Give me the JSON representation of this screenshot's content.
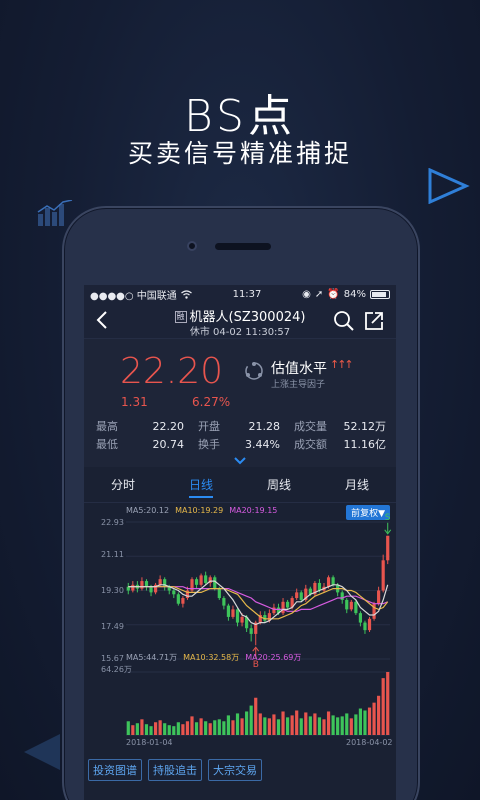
{
  "promo": {
    "title": "BS点",
    "subtitle": "买卖信号精准捕捉"
  },
  "statusbar": {
    "carrier": "●●●●○ 中国联通",
    "time": "11:37",
    "battery": "84%"
  },
  "nav": {
    "badge": "融",
    "title": "机器人(SZ300024)",
    "subtitle": "休市 04-02 11:30:57"
  },
  "quote": {
    "price": "22.20",
    "change": "1.31",
    "change_pct": "6.27%",
    "valuation_label": "估值水平",
    "valuation_arrows": "↑↑↑",
    "valuation_sub": "上涨主导因子",
    "stats": [
      [
        {
          "label": "最高",
          "value": "22.20"
        },
        {
          "label": "开盘",
          "value": "21.28"
        },
        {
          "label": "成交量",
          "value": "52.12万"
        }
      ],
      [
        {
          "label": "最低",
          "value": "20.74"
        },
        {
          "label": "换手",
          "value": "3.44%"
        },
        {
          "label": "成交额",
          "value": "11.16亿"
        }
      ]
    ]
  },
  "tabs": [
    {
      "label": "分时",
      "active": false
    },
    {
      "label": "日线",
      "active": true
    },
    {
      "label": "周线",
      "active": false
    },
    {
      "label": "月线",
      "active": false
    }
  ],
  "chart_data": {
    "type": "candlestick",
    "ma_legend": {
      "ma5": "MA5:20.12",
      "ma10": "MA10:19.29",
      "ma20": "MA20:19.15"
    },
    "adjust_button": "前复权▼",
    "y_ticks": [
      "22.93",
      "21.11",
      "19.30",
      "17.49",
      "15.67"
    ],
    "ylim": [
      15.67,
      22.93
    ],
    "vol_legend": {
      "ma5": "MA5:44.71万",
      "ma10": "MA10:32.58万",
      "ma20": "MA20:25.69万"
    },
    "vol_max_label": "64.26万",
    "vol_max": 64.26,
    "x_start": "2018-01-04",
    "x_end": "2018-04-02",
    "signals": [
      {
        "label": "S",
        "index": 57
      },
      {
        "label": "B",
        "index": 28
      }
    ],
    "colors": {
      "up": "#e8554e",
      "down": "#3ec45b",
      "ma5": "#d8d8d8",
      "ma10": "#e6b84a",
      "ma20": "#d65be0"
    },
    "candles": [
      {
        "o": 19.5,
        "c": 19.3,
        "h": 19.7,
        "l": 19.1
      },
      {
        "o": 19.3,
        "c": 19.6,
        "h": 19.8,
        "l": 19.2
      },
      {
        "o": 19.6,
        "c": 19.4,
        "h": 19.8,
        "l": 19.2
      },
      {
        "o": 19.4,
        "c": 19.8,
        "h": 20.0,
        "l": 19.3
      },
      {
        "o": 19.8,
        "c": 19.5,
        "h": 19.9,
        "l": 19.3
      },
      {
        "o": 19.5,
        "c": 19.2,
        "h": 19.6,
        "l": 19.0
      },
      {
        "o": 19.2,
        "c": 19.6,
        "h": 19.7,
        "l": 19.1
      },
      {
        "o": 19.6,
        "c": 19.9,
        "h": 20.1,
        "l": 19.5
      },
      {
        "o": 19.9,
        "c": 19.5,
        "h": 20.0,
        "l": 19.3
      },
      {
        "o": 19.5,
        "c": 19.3,
        "h": 19.6,
        "l": 19.1
      },
      {
        "o": 19.3,
        "c": 19.1,
        "h": 19.4,
        "l": 18.9
      },
      {
        "o": 19.1,
        "c": 18.6,
        "h": 19.2,
        "l": 18.5
      },
      {
        "o": 18.6,
        "c": 18.9,
        "h": 19.0,
        "l": 18.4
      },
      {
        "o": 18.9,
        "c": 19.3,
        "h": 19.5,
        "l": 18.8
      },
      {
        "o": 19.3,
        "c": 19.9,
        "h": 20.0,
        "l": 19.2
      },
      {
        "o": 19.9,
        "c": 19.6,
        "h": 20.0,
        "l": 19.4
      },
      {
        "o": 19.6,
        "c": 20.1,
        "h": 20.2,
        "l": 19.5
      },
      {
        "o": 20.1,
        "c": 19.7,
        "h": 20.3,
        "l": 19.6
      },
      {
        "o": 19.7,
        "c": 20.0,
        "h": 20.1,
        "l": 19.5
      },
      {
        "o": 20.0,
        "c": 19.4,
        "h": 20.1,
        "l": 19.3
      },
      {
        "o": 19.4,
        "c": 18.9,
        "h": 19.5,
        "l": 18.8
      },
      {
        "o": 18.9,
        "c": 18.5,
        "h": 19.0,
        "l": 18.3
      },
      {
        "o": 18.5,
        "c": 17.9,
        "h": 18.6,
        "l": 17.7
      },
      {
        "o": 17.9,
        "c": 18.3,
        "h": 18.5,
        "l": 17.8
      },
      {
        "o": 18.3,
        "c": 17.6,
        "h": 18.4,
        "l": 17.4
      },
      {
        "o": 17.6,
        "c": 17.9,
        "h": 18.1,
        "l": 17.4
      },
      {
        "o": 17.9,
        "c": 17.3,
        "h": 18.0,
        "l": 17.1
      },
      {
        "o": 17.3,
        "c": 17.0,
        "h": 17.5,
        "l": 16.6
      },
      {
        "o": 17.0,
        "c": 17.6,
        "h": 17.7,
        "l": 16.4
      },
      {
        "o": 17.6,
        "c": 18.0,
        "h": 18.2,
        "l": 17.5
      },
      {
        "o": 18.0,
        "c": 17.7,
        "h": 18.2,
        "l": 17.6
      },
      {
        "o": 17.7,
        "c": 18.1,
        "h": 18.3,
        "l": 17.6
      },
      {
        "o": 18.1,
        "c": 18.4,
        "h": 18.6,
        "l": 18.0
      },
      {
        "o": 18.4,
        "c": 18.1,
        "h": 18.6,
        "l": 18.0
      },
      {
        "o": 18.1,
        "c": 18.7,
        "h": 18.9,
        "l": 18.0
      },
      {
        "o": 18.7,
        "c": 18.4,
        "h": 18.8,
        "l": 18.3
      },
      {
        "o": 18.4,
        "c": 18.9,
        "h": 19.0,
        "l": 18.3
      },
      {
        "o": 18.9,
        "c": 19.2,
        "h": 19.4,
        "l": 18.8
      },
      {
        "o": 19.2,
        "c": 18.8,
        "h": 19.3,
        "l": 18.7
      },
      {
        "o": 18.8,
        "c": 19.4,
        "h": 19.6,
        "l": 18.7
      },
      {
        "o": 19.4,
        "c": 19.1,
        "h": 19.5,
        "l": 19.0
      },
      {
        "o": 19.1,
        "c": 19.7,
        "h": 19.8,
        "l": 19.0
      },
      {
        "o": 19.7,
        "c": 19.3,
        "h": 19.9,
        "l": 19.2
      },
      {
        "o": 19.3,
        "c": 19.5,
        "h": 19.7,
        "l": 19.2
      },
      {
        "o": 19.5,
        "c": 20.0,
        "h": 20.1,
        "l": 19.4
      },
      {
        "o": 20.0,
        "c": 19.6,
        "h": 20.1,
        "l": 19.5
      },
      {
        "o": 19.6,
        "c": 19.2,
        "h": 19.7,
        "l": 19.0
      },
      {
        "o": 19.2,
        "c": 18.8,
        "h": 19.3,
        "l": 18.6
      },
      {
        "o": 18.8,
        "c": 18.3,
        "h": 18.9,
        "l": 18.1
      },
      {
        "o": 18.3,
        "c": 18.7,
        "h": 18.8,
        "l": 18.2
      },
      {
        "o": 18.7,
        "c": 18.1,
        "h": 18.8,
        "l": 18.0
      },
      {
        "o": 18.1,
        "c": 17.6,
        "h": 18.2,
        "l": 17.4
      },
      {
        "o": 17.6,
        "c": 17.2,
        "h": 17.7,
        "l": 17.0
      },
      {
        "o": 17.2,
        "c": 17.8,
        "h": 17.9,
        "l": 17.1
      },
      {
        "o": 17.8,
        "c": 18.6,
        "h": 18.7,
        "l": 17.7
      },
      {
        "o": 18.6,
        "c": 19.3,
        "h": 19.5,
        "l": 18.5
      },
      {
        "o": 19.3,
        "c": 20.9,
        "h": 21.2,
        "l": 19.2
      },
      {
        "o": 20.9,
        "c": 22.2,
        "h": 22.2,
        "l": 20.7
      }
    ],
    "ma_series": {
      "ma5": [
        19.5,
        19.5,
        19.5,
        19.5,
        19.5,
        19.5,
        19.5,
        19.6,
        19.6,
        19.5,
        19.4,
        19.3,
        19.1,
        19.0,
        19.0,
        19.2,
        19.4,
        19.6,
        19.8,
        19.8,
        19.6,
        19.4,
        19.1,
        18.8,
        18.4,
        18.0,
        17.9,
        17.6,
        17.5,
        17.6,
        17.6,
        17.7,
        17.9,
        18.1,
        18.3,
        18.3,
        18.4,
        18.7,
        18.7,
        18.9,
        19.1,
        19.2,
        19.3,
        19.4,
        19.5,
        19.6,
        19.6,
        19.5,
        19.3,
        19.0,
        18.8,
        18.4,
        18.2,
        18.0,
        18.0,
        18.2,
        18.8,
        19.6
      ],
      "ma10": [
        19.5,
        19.5,
        19.5,
        19.5,
        19.5,
        19.5,
        19.5,
        19.5,
        19.5,
        19.5,
        19.5,
        19.4,
        19.3,
        19.2,
        19.2,
        19.2,
        19.2,
        19.3,
        19.4,
        19.4,
        19.4,
        19.4,
        19.3,
        19.2,
        19.1,
        18.8,
        18.5,
        18.3,
        18.1,
        17.9,
        17.8,
        17.8,
        17.8,
        17.8,
        17.9,
        18.0,
        18.1,
        18.3,
        18.5,
        18.6,
        18.8,
        19.0,
        19.1,
        19.2,
        19.3,
        19.4,
        19.4,
        19.4,
        19.3,
        19.3,
        19.2,
        19.0,
        18.8,
        18.6,
        18.4,
        18.3,
        18.4,
        18.7
      ],
      "ma20": [
        19.5,
        19.5,
        19.5,
        19.5,
        19.5,
        19.5,
        19.5,
        19.5,
        19.5,
        19.5,
        19.5,
        19.5,
        19.5,
        19.4,
        19.4,
        19.4,
        19.4,
        19.4,
        19.4,
        19.4,
        19.4,
        19.4,
        19.4,
        19.3,
        19.2,
        19.1,
        19.0,
        18.9,
        18.7,
        18.6,
        18.5,
        18.4,
        18.3,
        18.3,
        18.3,
        18.2,
        18.2,
        18.2,
        18.3,
        18.3,
        18.3,
        18.4,
        18.5,
        18.6,
        18.7,
        18.8,
        18.9,
        18.9,
        19.0,
        19.0,
        19.0,
        18.9,
        18.8,
        18.7,
        18.6,
        18.6,
        18.6,
        18.7
      ]
    },
    "volumes": [
      14,
      10,
      12,
      16,
      11,
      9,
      13,
      15,
      12,
      10,
      9,
      13,
      11,
      14,
      19,
      13,
      17,
      14,
      12,
      15,
      16,
      14,
      20,
      15,
      22,
      17,
      24,
      30,
      38,
      22,
      18,
      17,
      21,
      16,
      24,
      18,
      20,
      25,
      17,
      23,
      19,
      22,
      18,
      16,
      24,
      20,
      18,
      19,
      22,
      17,
      21,
      27,
      25,
      28,
      33,
      40,
      58,
      64.26
    ]
  },
  "bottom_tags": [
    "投资图谱",
    "持股追击",
    "大宗交易"
  ]
}
